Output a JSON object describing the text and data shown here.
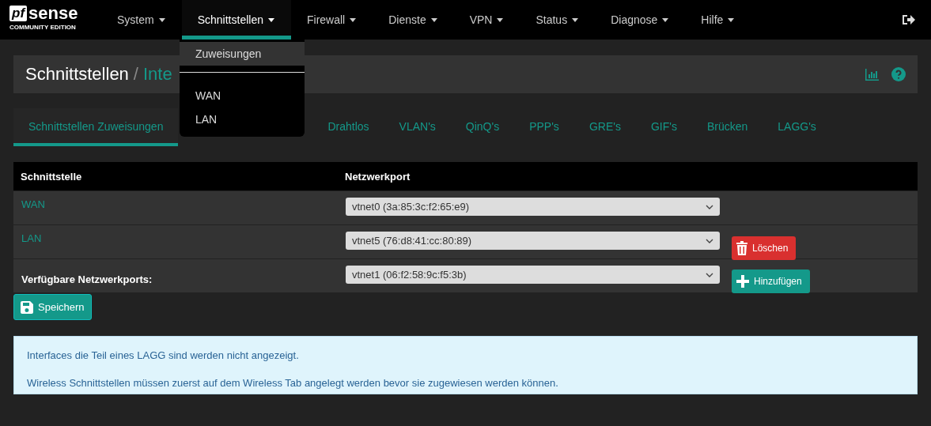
{
  "brand": {
    "logo_mark": "pf",
    "logo_word": "sense",
    "edition": "COMMUNITY EDITION"
  },
  "nav": [
    {
      "label": "System",
      "selected": false
    },
    {
      "label": "Schnittstellen",
      "selected": true
    },
    {
      "label": "Firewall",
      "selected": false
    },
    {
      "label": "Dienste",
      "selected": false
    },
    {
      "label": "VPN",
      "selected": false
    },
    {
      "label": "Status",
      "selected": false
    },
    {
      "label": "Diagnose",
      "selected": false
    },
    {
      "label": "Hilfe",
      "selected": false
    }
  ],
  "dropdown": [
    {
      "kind": "item",
      "label": "Zuweisungen",
      "selected": true
    },
    {
      "kind": "divider"
    },
    {
      "kind": "item",
      "label": "WAN",
      "selected": false
    },
    {
      "kind": "item",
      "label": "LAN",
      "selected": false
    }
  ],
  "breadcrumb": {
    "section": "Schnittstellen",
    "separator": "/",
    "page": "Inte"
  },
  "tabs": [
    {
      "label": "Schnittstellen Zuweisungen",
      "selected": true
    },
    {
      "label": "Drahtlos",
      "selected": false
    },
    {
      "label": "VLAN's",
      "selected": false
    },
    {
      "label": "QinQ's",
      "selected": false
    },
    {
      "label": "PPP's",
      "selected": false
    },
    {
      "label": "GRE's",
      "selected": false
    },
    {
      "label": "GIF's",
      "selected": false
    },
    {
      "label": "Brücken",
      "selected": false
    },
    {
      "label": "LAGG's",
      "selected": false
    }
  ],
  "table": {
    "columns": [
      "Schnittstelle",
      "Netzwerkport"
    ],
    "rows": [
      {
        "kind": "assigned",
        "name": "WAN",
        "port": "vtnet0 (3a:85:3c:f2:65:e9)"
      },
      {
        "kind": "assigned",
        "name": "LAN",
        "port": "vtnet5 (76:d8:41:cc:80:89)",
        "action": "Löschen"
      },
      {
        "kind": "available",
        "name": "Verfügbare Netzwerkports:",
        "port": "vtnet1 (06:f2:58:9c:f5:3b)",
        "action": "Hinzufügen"
      }
    ]
  },
  "save_button": "Speichern",
  "info": [
    "Interfaces die Teil eines LAGG sind werden nicht angezeigt.",
    "Wireless Schnittstellen müssen zuerst auf dem Wireless Tab angelegt werden bevor sie zugewiesen werden können."
  ]
}
